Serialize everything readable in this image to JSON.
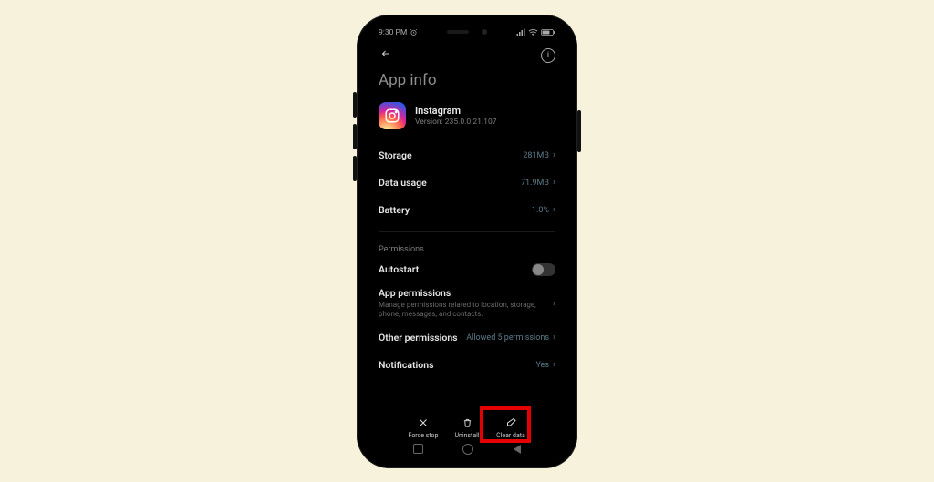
{
  "statusbar": {
    "time": "9:30 PM"
  },
  "page": {
    "title": "App info"
  },
  "app": {
    "name": "Instagram",
    "version_label": "Version: 235.0.0.21.107"
  },
  "rows": {
    "storage": {
      "label": "Storage",
      "value": "281MB"
    },
    "data_usage": {
      "label": "Data usage",
      "value": "71.9MB"
    },
    "battery": {
      "label": "Battery",
      "value": "1.0%"
    },
    "autostart": {
      "label": "Autostart"
    },
    "app_perms": {
      "label": "App permissions",
      "sub": "Manage permissions related to location, storage, phone, messages, and contacts."
    },
    "other_perms": {
      "label": "Other permissions",
      "value": "Allowed 5 permissions"
    },
    "notifications": {
      "label": "Notifications",
      "value": "Yes"
    }
  },
  "sections": {
    "permissions": "Permissions"
  },
  "actions": {
    "force_stop": "Force stop",
    "uninstall": "Uninstall",
    "clear_data": "Clear data"
  }
}
